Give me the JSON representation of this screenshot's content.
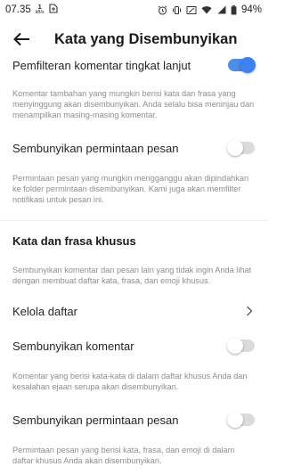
{
  "status": {
    "time": "07.35",
    "net_value": "1",
    "net_unit": "kB/s",
    "battery": "94%"
  },
  "header": {
    "title": "Kata yang Disembunyikan"
  },
  "advanced_filter": {
    "label": "Pemfilteran komentar tingkat lanjut",
    "enabled": true,
    "description": "Komentar tambahan yang mungkin berisi kata dan frasa yang menyinggung akan disembunyikan. Anda selalu bisa meninjau dan menampilkan masing-masing komentar."
  },
  "hide_requests": {
    "label": "Sembunyikan permintaan pesan",
    "enabled": false,
    "description": "Permintaan pesan yang mungkin mengganggu akan dipindahkan ke folder permintaan disembunyikan. Kami juga akan memfilter notifikasi untuk pesan ini."
  },
  "custom_section": {
    "title": "Kata dan frasa khusus",
    "description": "Sembunyikan komentar dan pesan lain yang tidak ingin Anda lihat dengan membuat daftar kata, frasa, dan emoji khusus."
  },
  "manage_list": {
    "label": "Kelola daftar"
  },
  "custom_hide_comments": {
    "label": "Sembunyikan komentar",
    "enabled": false,
    "description": "Komentar yang berisi kata-kata di dalam daftar khusus Anda dan kesalahan ejaan serupa akan disembunyikan."
  },
  "custom_hide_requests": {
    "label": "Sembunyikan permintaan pesan",
    "enabled": false,
    "description": "Permintaan pesan yang berisi kata, frasa, dan emoji di dalam daftar khusus Anda akan disembunyikan."
  },
  "colors": {
    "toggle_on": "#3b82f6",
    "toggle_off": "#dbdbdb",
    "text_primary": "#262626",
    "text_secondary": "#8e8e8e"
  }
}
